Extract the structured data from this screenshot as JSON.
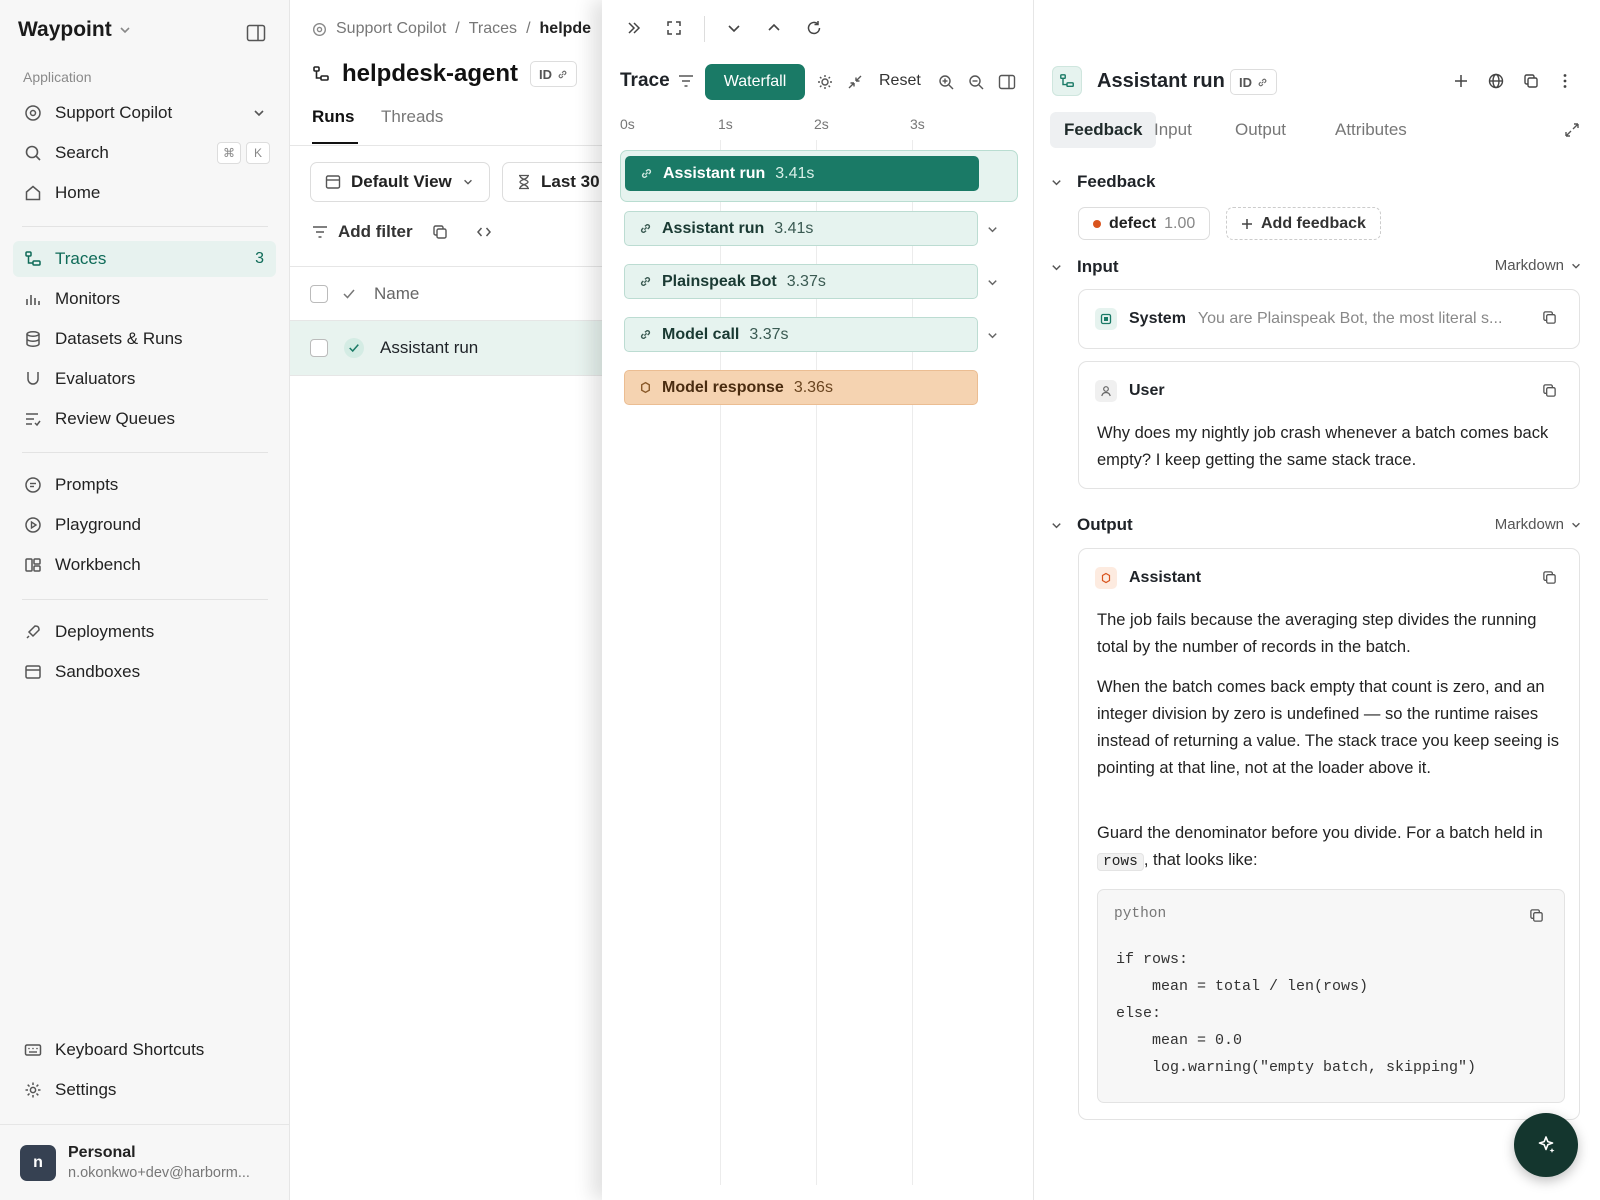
{
  "sidebar": {
    "brand": "Waypoint",
    "section_label": "Application",
    "project": "Support Copilot",
    "search": {
      "label": "Search",
      "k1": "⌘",
      "k2": "K"
    },
    "items": [
      {
        "label": "Home"
      },
      {
        "label": "Traces",
        "count": "3"
      },
      {
        "label": "Monitors"
      },
      {
        "label": "Datasets & Runs"
      },
      {
        "label": "Evaluators"
      },
      {
        "label": "Review Queues"
      },
      {
        "label": "Prompts"
      },
      {
        "label": "Playground"
      },
      {
        "label": "Workbench"
      },
      {
        "label": "Deployments"
      },
      {
        "label": "Sandboxes"
      },
      {
        "label": "Keyboard Shortcuts"
      },
      {
        "label": "Settings"
      }
    ],
    "user": {
      "initial": "n",
      "name": "Personal",
      "email": "n.okonkwo+dev@harborm..."
    }
  },
  "middle": {
    "breadcrumb": {
      "a": "Support Copilot",
      "sep": "/",
      "b": "Traces",
      "c": "helpde"
    },
    "title": "helpdesk-agent",
    "id_badge": "ID",
    "tabs": {
      "runs": "Runs",
      "threads": "Threads"
    },
    "view_button": "Default View",
    "time_button": "Last 30",
    "add_filter": "Add filter",
    "column_name": "Name",
    "row_name": "Assistant run"
  },
  "trace": {
    "title": "Trace",
    "waterfall": "Waterfall",
    "reset": "Reset",
    "ticks": [
      "0s",
      "1s",
      "2s",
      "3s"
    ],
    "spans": [
      {
        "name": "Assistant run",
        "duration": "3.41s",
        "selected": true
      },
      {
        "name": "Assistant run",
        "duration": "3.41s"
      },
      {
        "name": "Plainspeak Bot",
        "duration": "3.37s"
      },
      {
        "name": "Model call",
        "duration": "3.37s"
      },
      {
        "name": "Model response",
        "duration": "3.36s"
      }
    ]
  },
  "detail": {
    "title": "Assistant run",
    "id_badge": "ID",
    "tabs": [
      "Feedback",
      "Input",
      "Output",
      "Attributes"
    ],
    "feedback": {
      "heading": "Feedback",
      "tag_label": "defect",
      "tag_value": "1.00",
      "add_label": "Add feedback"
    },
    "input": {
      "heading": "Input",
      "format": "Markdown",
      "system_role": "System",
      "system_preview": "You are Plainspeak Bot, the most literal s...",
      "user_role": "User",
      "user_text": "Why does my nightly job crash whenever a batch comes back empty? I keep getting the same stack trace."
    },
    "output": {
      "heading": "Output",
      "format": "Markdown",
      "role": "Assistant",
      "p1": "The job fails because the averaging step divides the running total by the number of records in the batch.",
      "p2": "When the batch comes back empty that count is zero, and an integer division by zero is undefined — so the runtime raises instead of returning a value. The stack trace you keep seeing is pointing at that line, not at the loader above it.",
      "p3_pre": "Guard the denominator before you divide. For a batch held in",
      "p3_code": "rows",
      "p3_post": ", that looks like:",
      "code_lang": "python",
      "code_lines": [
        "if rows:",
        "    mean = total / len(rows)",
        "else:",
        "    mean = 0.0",
        "    log.warning(\"empty batch, skipping\")"
      ]
    }
  },
  "colors": {
    "accent": "#1a7a66",
    "accent_light": "#e6f3ef",
    "response_bar": "#f5d3b1"
  }
}
